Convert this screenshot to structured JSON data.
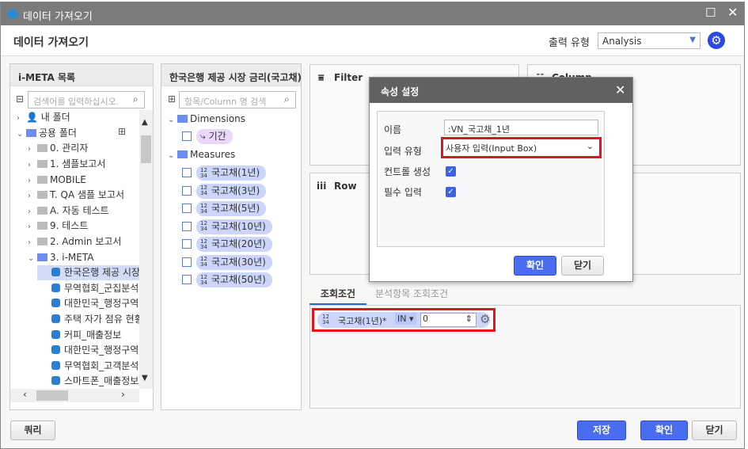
{
  "window": {
    "title": "데이터 가져오기",
    "header": "데이터 가져오기",
    "output_type_label": "출력 유형",
    "output_type_value": "Analysis"
  },
  "left": {
    "title": "i-META 목록",
    "search_placeholder": "검색어를 입력하십시오.",
    "items": [
      {
        "label": "내 폴더"
      },
      {
        "label": "공용 폴더"
      },
      {
        "label": "0. 관리자"
      },
      {
        "label": "1. 샘플보고서"
      },
      {
        "label": "MOBILE"
      },
      {
        "label": "T. QA 샘플 보고서"
      },
      {
        "label": "A. 자동 테스트"
      },
      {
        "label": "9. 테스트"
      },
      {
        "label": "2. Admin 보고서"
      },
      {
        "label": "3. i-META"
      }
    ],
    "metas": [
      {
        "label": "한국은행 제공 시장"
      },
      {
        "label": "무역협회_군집분석"
      },
      {
        "label": "대한민국_행정구역"
      },
      {
        "label": "주택 자가 점유 현황"
      },
      {
        "label": "커피_매출정보"
      },
      {
        "label": "대한민국_행정구역"
      },
      {
        "label": "무역협회_고객분석"
      },
      {
        "label": "스마트폰_매출정보"
      }
    ]
  },
  "mid": {
    "title": "한국은행 제공 시장 금리(국고채)",
    "search_placeholder": "항목/Column 명 검색",
    "dimensions_label": "Dimensions",
    "dimension": "기간",
    "measures_label": "Measures",
    "measures": [
      "국고채(1년)",
      "국고채(3년)",
      "국고채(5년)",
      "국고채(10년)",
      "국고채(20년)",
      "국고채(30년)",
      "국고채(50년)"
    ]
  },
  "zones": {
    "filter": "Filter",
    "column": "Column",
    "row": "Row"
  },
  "tabs": {
    "t1": "조회조건",
    "t2": "분석항목 조회조건"
  },
  "condition": {
    "field": "국고채(1년)*",
    "op": "IN",
    "value": "0"
  },
  "dialog": {
    "title": "속성 설정",
    "name_label": "이름",
    "name_value": ":VN_국고채_1년",
    "type_label": "입력 유형",
    "type_value": "사용자 입력(Input Box)",
    "ctrl_label": "컨트롤 생성",
    "ctrl_checked": true,
    "req_label": "필수 입력",
    "req_checked": true,
    "ok": "확인",
    "close": "닫기"
  },
  "footer": {
    "query": "쿼리",
    "save": "저장",
    "ok": "확인",
    "close": "닫기"
  },
  "icons": {
    "num": "12\n34"
  }
}
